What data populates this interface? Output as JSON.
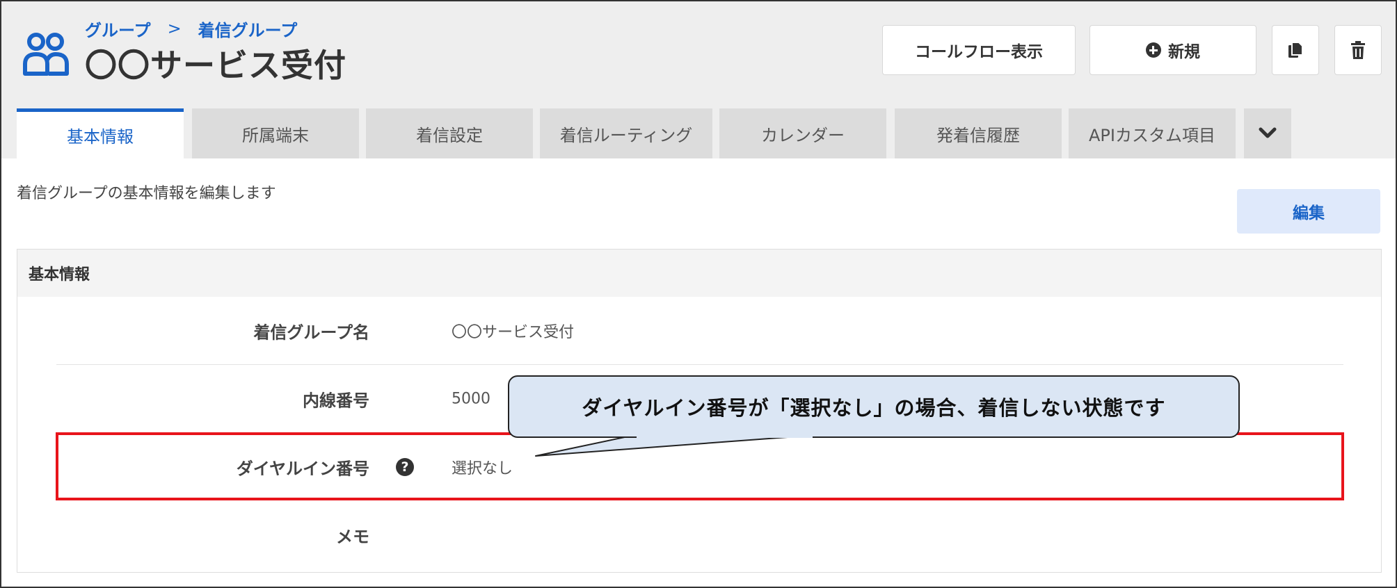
{
  "header": {
    "breadcrumb": [
      "グループ",
      "着信グループ"
    ],
    "breadcrumb_separator": ">",
    "title": "〇〇サービス受付",
    "callflow_label": "コールフロー表示",
    "new_label": "新規"
  },
  "tabs": [
    {
      "label": "基本情報",
      "active": true
    },
    {
      "label": "所属端末",
      "active": false
    },
    {
      "label": "着信設定",
      "active": false
    },
    {
      "label": "着信ルーティング",
      "active": false
    },
    {
      "label": "カレンダー",
      "active": false
    },
    {
      "label": "発着信履歴",
      "active": false
    },
    {
      "label": "APIカスタム項目",
      "active": false
    }
  ],
  "main": {
    "description": "着信グループの基本情報を編集します",
    "edit_label": "編集",
    "panel_title": "基本情報",
    "fields": [
      {
        "label": "着信グループ名",
        "value": "〇〇サービス受付"
      },
      {
        "label": "内線番号",
        "value": "5000"
      },
      {
        "label": "ダイヤルイン番号",
        "value": "選択なし"
      },
      {
        "label": "メモ",
        "value": ""
      }
    ]
  },
  "callout": {
    "text": "ダイヤルイン番号が「選択なし」の場合、着信しない状態です"
  },
  "colors": {
    "accent": "#1a64c8",
    "highlight": "#e8141b",
    "callout_bg": "#dbe6f4"
  },
  "icons": {
    "group": "group-icon",
    "plus": "plus-circle-icon",
    "copy": "copy-icon",
    "delete": "trash-icon",
    "more": "chevron-down-icon",
    "help": "question-circle-icon"
  }
}
